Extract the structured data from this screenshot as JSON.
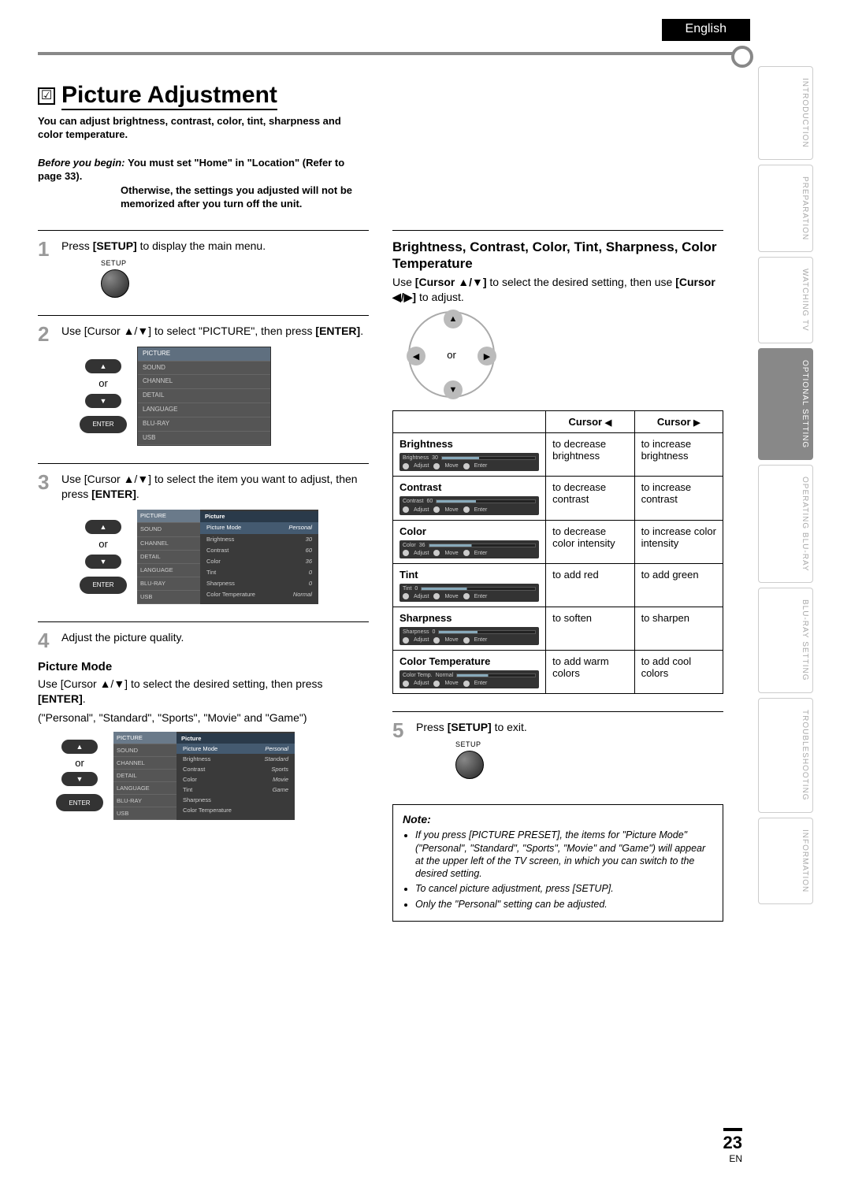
{
  "header": {
    "lang_tab": "English"
  },
  "side_tabs": {
    "items": [
      "INTRODUCTION",
      "PREPARATION",
      "WATCHING  TV",
      "OPTIONAL  SETTING",
      "OPERATING  BLU-RAY",
      "BLU-RAY  SETTING",
      "TROUBLESHOOTING",
      "INFORMATION"
    ],
    "active_index": 3
  },
  "title": {
    "icon": "☑",
    "text": "Picture Adjustment"
  },
  "intro": "You can adjust brightness, contrast, color, tint, sharpness and color temperature.",
  "before": {
    "label": "Before you begin:",
    "line1": "You must set \"Home\" in \"Location\" (Refer to page 33).",
    "line2": "Otherwise, the settings you adjusted will not be memorized after you turn off the unit."
  },
  "labels": {
    "setup": "SETUP",
    "or": "or",
    "enter": "ENTER",
    "adjust": "Adjust",
    "move": "Move",
    "enter_sm": "Enter"
  },
  "steps": {
    "s1": "Press [SETUP] to display the main menu.",
    "s2_a": "Use [Cursor ▲/▼] to select \"PICTURE\", then press ",
    "s2_b": "[ENTER]",
    "s2_c": ".",
    "s3_a": "Use [Cursor ▲/▼] to select the item you want to adjust, then press ",
    "s3_b": "[ENTER]",
    "s3_c": ".",
    "s4": "Adjust the picture quality.",
    "s5": "Press [SETUP] to exit."
  },
  "menu_small": {
    "items": [
      "PICTURE",
      "SOUND",
      "CHANNEL",
      "DETAIL",
      "LANGUAGE",
      "BLU-RAY",
      "USB"
    ]
  },
  "picture_menu": {
    "header": "Picture",
    "rows": [
      {
        "k": "Picture Mode",
        "v": "Personal",
        "hl": true
      },
      {
        "k": "Brightness",
        "v": "30"
      },
      {
        "k": "Contrast",
        "v": "60"
      },
      {
        "k": "Color",
        "v": "36"
      },
      {
        "k": "Tint",
        "v": "0"
      },
      {
        "k": "Sharpness",
        "v": "0"
      },
      {
        "k": "Color Temperature",
        "v": "Normal"
      }
    ]
  },
  "picture_menu_modes": {
    "header": "Picture",
    "rows": [
      {
        "k": "Picture Mode",
        "v": "Personal",
        "hl": true
      },
      {
        "k": "Brightness",
        "v": "Standard"
      },
      {
        "k": "Contrast",
        "v": "Sports"
      },
      {
        "k": "Color",
        "v": "Movie"
      },
      {
        "k": "Tint",
        "v": "Game"
      },
      {
        "k": "Sharpness",
        "v": ""
      },
      {
        "k": "Color Temperature",
        "v": ""
      }
    ]
  },
  "picture_mode": {
    "heading": "Picture Mode",
    "text_a": "Use [Cursor ▲/▼] to select the desired setting, then press ",
    "text_b": "[ENTER]",
    "text_c": ".",
    "modes": "(\"Personal\", \"Standard\", \"Sports\", \"Movie\" and \"Game\")"
  },
  "right": {
    "heading": "Brightness, Contrast, Color, Tint, Sharpness, Color Temperature",
    "text": "Use [Cursor ▲/▼] to select the desired setting, then use [Cursor ◀/▶] to adjust."
  },
  "adjust_table": {
    "head_empty": "",
    "head_left": "Cursor ◀",
    "head_right": "Cursor ▶",
    "rows": [
      {
        "name": "Brightness",
        "osd_label": "Brightness",
        "osd_val": "30",
        "left": "to decrease brightness",
        "right": "to increase brightness"
      },
      {
        "name": "Contrast",
        "osd_label": "Contrast",
        "osd_val": "60",
        "left": "to decrease contrast",
        "right": "to increase contrast"
      },
      {
        "name": "Color",
        "osd_label": "Color",
        "osd_val": "36",
        "left": "to decrease color intensity",
        "right": "to increase color intensity"
      },
      {
        "name": "Tint",
        "osd_label": "Tint",
        "osd_val": "0",
        "left": "to add red",
        "right": "to add green"
      },
      {
        "name": "Sharpness",
        "osd_label": "Sharpness",
        "osd_val": "0",
        "left": "to soften",
        "right": "to sharpen"
      },
      {
        "name": "Color Temperature",
        "osd_label": "Color Temp.",
        "osd_val": "Normal",
        "left": "to add warm colors",
        "right": "to add cool colors"
      }
    ]
  },
  "note": {
    "label": "Note:",
    "items": [
      "If you press [PICTURE PRESET], the items for \"Picture Mode\" (\"Personal\", \"Standard\", \"Sports\", \"Movie\" and \"Game\") will appear at the upper left of the TV screen, in which you can switch to the desired setting.",
      "To cancel picture adjustment, press [SETUP].",
      "Only the \"Personal\" setting can be adjusted."
    ]
  },
  "footer": {
    "page": "23",
    "lang": "EN"
  }
}
